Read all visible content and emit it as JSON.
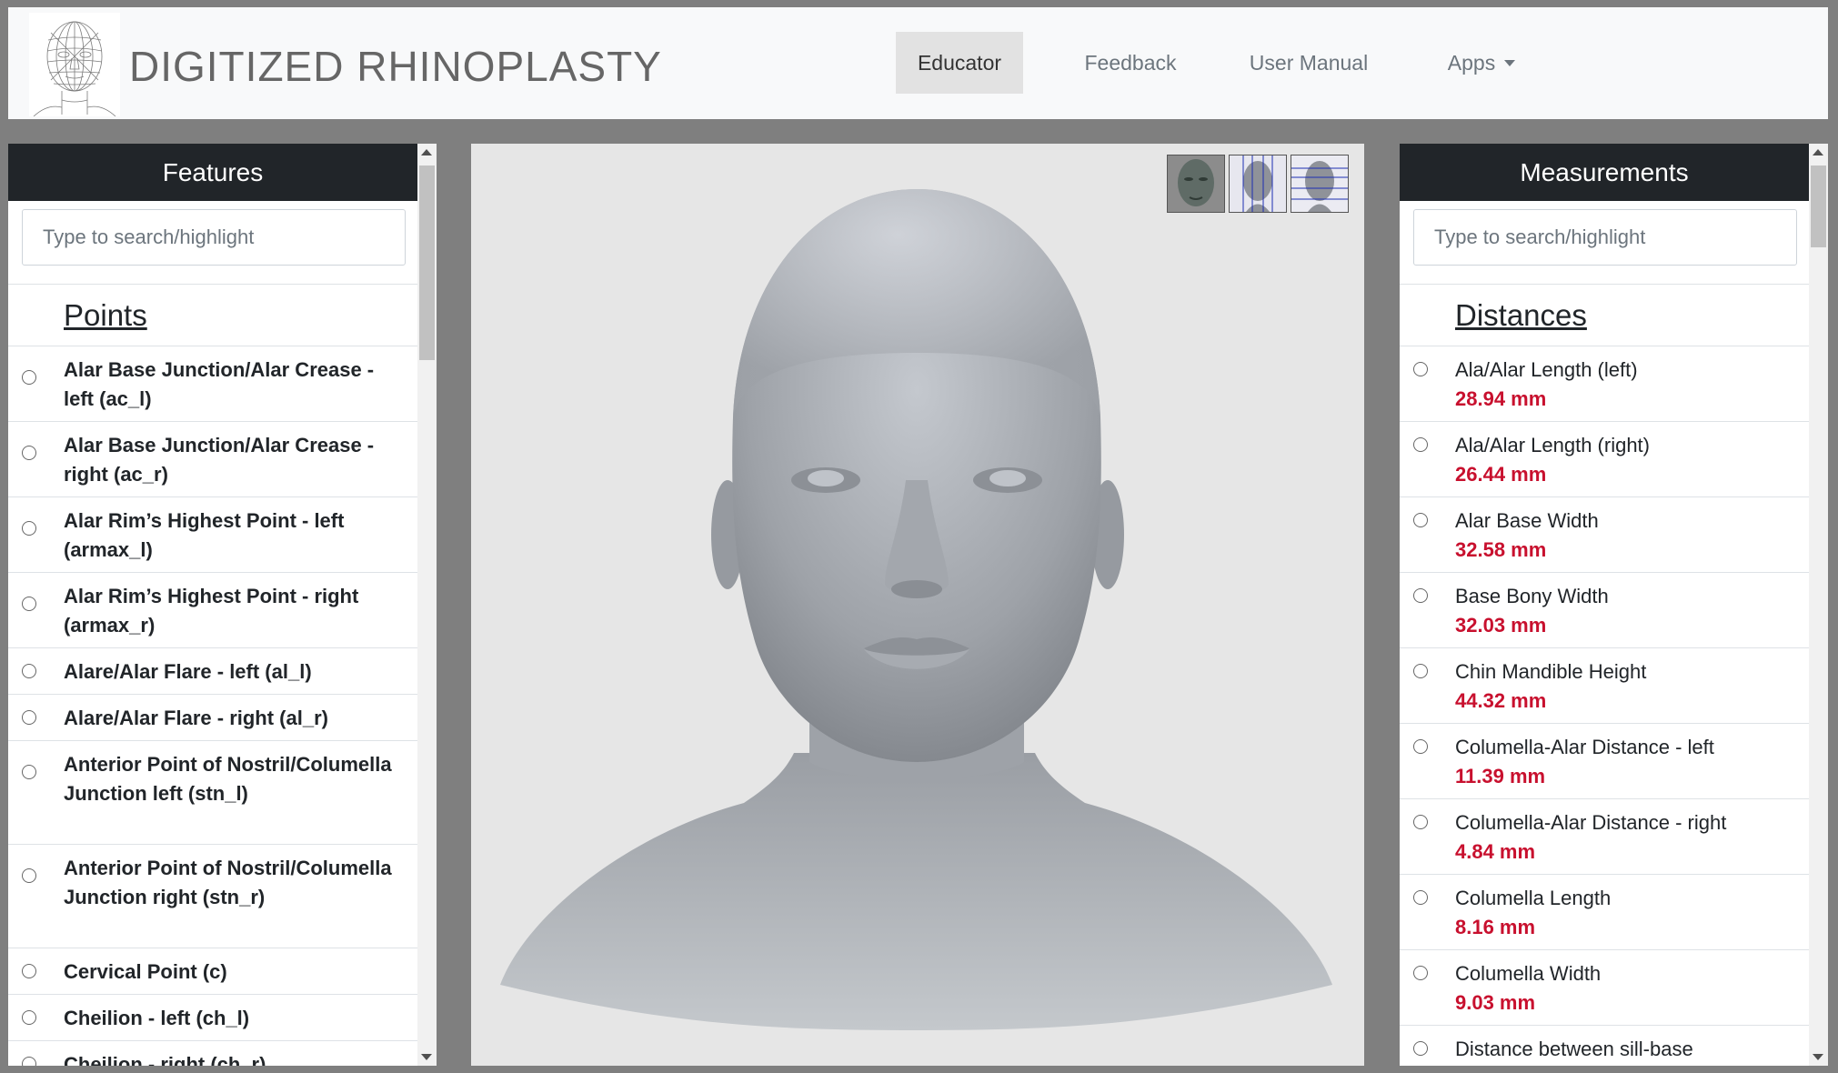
{
  "app": {
    "title": "DIGITIZED RHINOPLASTY"
  },
  "nav": {
    "items": [
      {
        "label": "Educator",
        "active": true
      },
      {
        "label": "Feedback"
      },
      {
        "label": "User Manual"
      },
      {
        "label": "Apps",
        "dropdown": true
      }
    ]
  },
  "features": {
    "title": "Features",
    "search_placeholder": "Type to search/highlight",
    "section": "Points",
    "items": [
      "Alar Base Junction/Alar Crease - left (ac_l)",
      "Alar Base Junction/Alar Crease - right (ac_r)",
      "Alar Rim’s Highest Point - left (armax_l)",
      "Alar Rim’s Highest Point - right (armax_r)",
      "Alare/Alar Flare - left (al_l)",
      "Alare/Alar Flare - right (al_r)",
      "Anterior Point of Nostril/Columella Junction left (stn_l)",
      "Anterior Point of Nostril/Columella Junction right (stn_r)",
      "Cervical Point (c)",
      "Cheilion - left (ch_l)",
      "Cheilion - right (ch_r)"
    ]
  },
  "measurements": {
    "title": "Measurements",
    "search_placeholder": "Type to search/highlight",
    "section": "Distances",
    "items": [
      {
        "name": "Ala/Alar Length (left)",
        "value": "28.94 mm"
      },
      {
        "name": "Ala/Alar Length (right)",
        "value": "26.44 mm"
      },
      {
        "name": "Alar Base Width",
        "value": "32.58 mm"
      },
      {
        "name": "Base Bony Width",
        "value": "32.03 mm"
      },
      {
        "name": "Chin Mandible Height",
        "value": "44.32 mm"
      },
      {
        "name": "Columella-Alar Distance - left",
        "value": "11.39 mm"
      },
      {
        "name": "Columella-Alar Distance - right",
        "value": "4.84 mm"
      },
      {
        "name": "Columella Length",
        "value": "8.16 mm"
      },
      {
        "name": "Columella Width",
        "value": "9.03 mm"
      },
      {
        "name": "Distance between sill-base",
        "value": ""
      }
    ]
  },
  "viewer": {
    "view_buttons": [
      "face-texture-view-icon",
      "grid-lines-view-icon",
      "horizontal-lines-view-icon"
    ]
  },
  "colors": {
    "navbar_bg": "#f8f9fa",
    "panel_header_bg": "#212529",
    "measurement_value": "#c8102e",
    "viewer_bg": "#e6e6e6",
    "page_bg": "#7f7f7f"
  }
}
